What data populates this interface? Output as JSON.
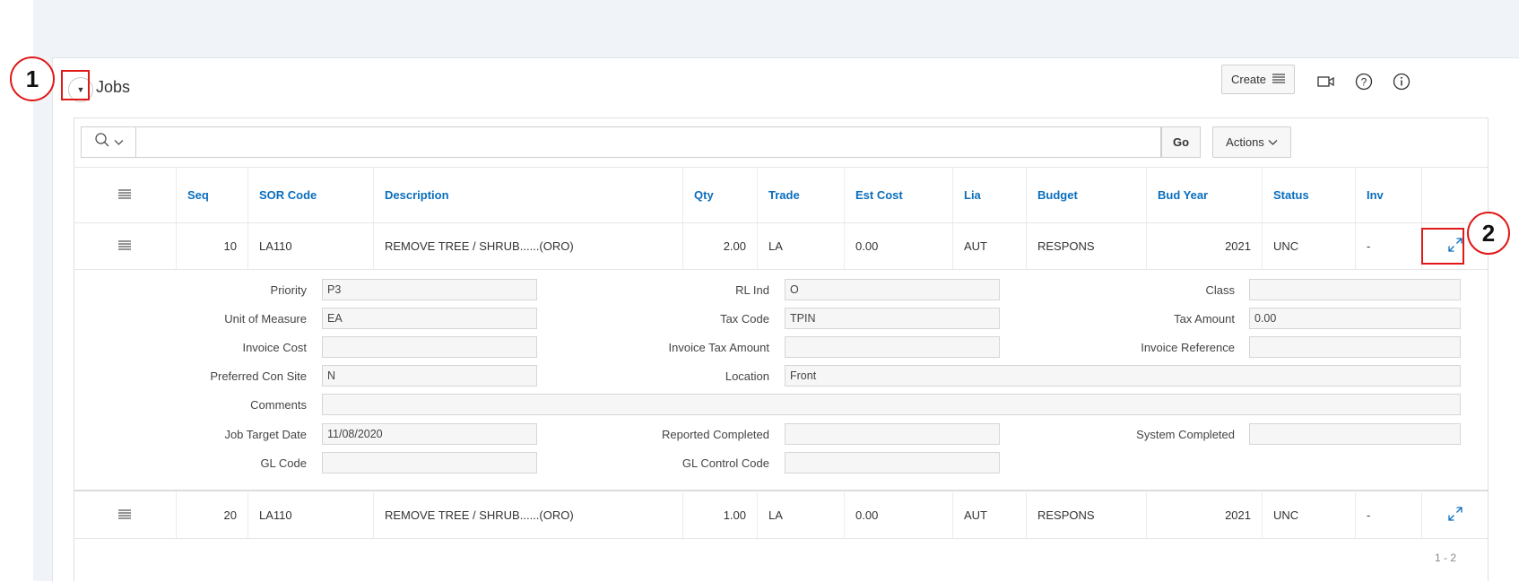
{
  "callouts": [
    "1",
    "2"
  ],
  "region": {
    "title": "Jobs",
    "create_label": "Create",
    "collapse_glyph": "▼"
  },
  "toolbar": {
    "search_placeholder": "",
    "go_label": "Go",
    "actions_label": "Actions"
  },
  "columns": [
    "Seq",
    "SOR Code",
    "Description",
    "Qty",
    "Trade",
    "Est Cost",
    "Lia",
    "Budget",
    "Bud Year",
    "Status",
    "Inv"
  ],
  "rows": [
    {
      "seq": "10",
      "sor_code": "LA110",
      "description": "REMOVE TREE / SHRUB......(ORO)",
      "qty": "2.00",
      "trade": "LA",
      "est_cost": "0.00",
      "lia": "AUT",
      "budget": "RESPONS",
      "bud_year": "2021",
      "status": "UNC",
      "inv": "-"
    },
    {
      "seq": "20",
      "sor_code": "LA110",
      "description": "REMOVE TREE / SHRUB......(ORO)",
      "qty": "1.00",
      "trade": "LA",
      "est_cost": "0.00",
      "lia": "AUT",
      "budget": "RESPONS",
      "bud_year": "2021",
      "status": "UNC",
      "inv": "-"
    }
  ],
  "detail": {
    "priority_label": "Priority",
    "priority": "P3",
    "rl_ind_label": "RL Ind",
    "rl_ind": "O",
    "class_label": "Class",
    "class": "",
    "uom_label": "Unit of Measure",
    "uom": "EA",
    "tax_code_label": "Tax Code",
    "tax_code": "TPIN",
    "tax_amount_label": "Tax Amount",
    "tax_amount": "0.00",
    "invoice_cost_label": "Invoice Cost",
    "invoice_cost": "",
    "invoice_tax_amount_label": "Invoice Tax Amount",
    "invoice_tax_amount": "",
    "invoice_reference_label": "Invoice Reference",
    "invoice_reference": "",
    "preferred_con_site_label": "Preferred Con Site",
    "preferred_con_site": "N",
    "location_label": "Location",
    "location": "Front",
    "comments_label": "Comments",
    "comments": "",
    "job_target_date_label": "Job Target Date",
    "job_target_date": "11/08/2020",
    "reported_completed_label": "Reported Completed",
    "reported_completed": "",
    "system_completed_label": "System Completed",
    "system_completed": "",
    "gl_code_label": "GL Code",
    "gl_code": "",
    "gl_control_code_label": "GL Control Code",
    "gl_control_code": ""
  },
  "pagination": "1 - 2",
  "icons": {
    "search": "search-icon",
    "chevron": "chevron-down-icon",
    "menu": "hamburger-menu-icon",
    "camera": "video-camera-icon",
    "help": "help-icon",
    "info": "info-icon",
    "expand": "expand-icon"
  },
  "colors": {
    "accent": "#0a6ebd",
    "callout": "#e01818",
    "background": "#f0f4f8"
  }
}
